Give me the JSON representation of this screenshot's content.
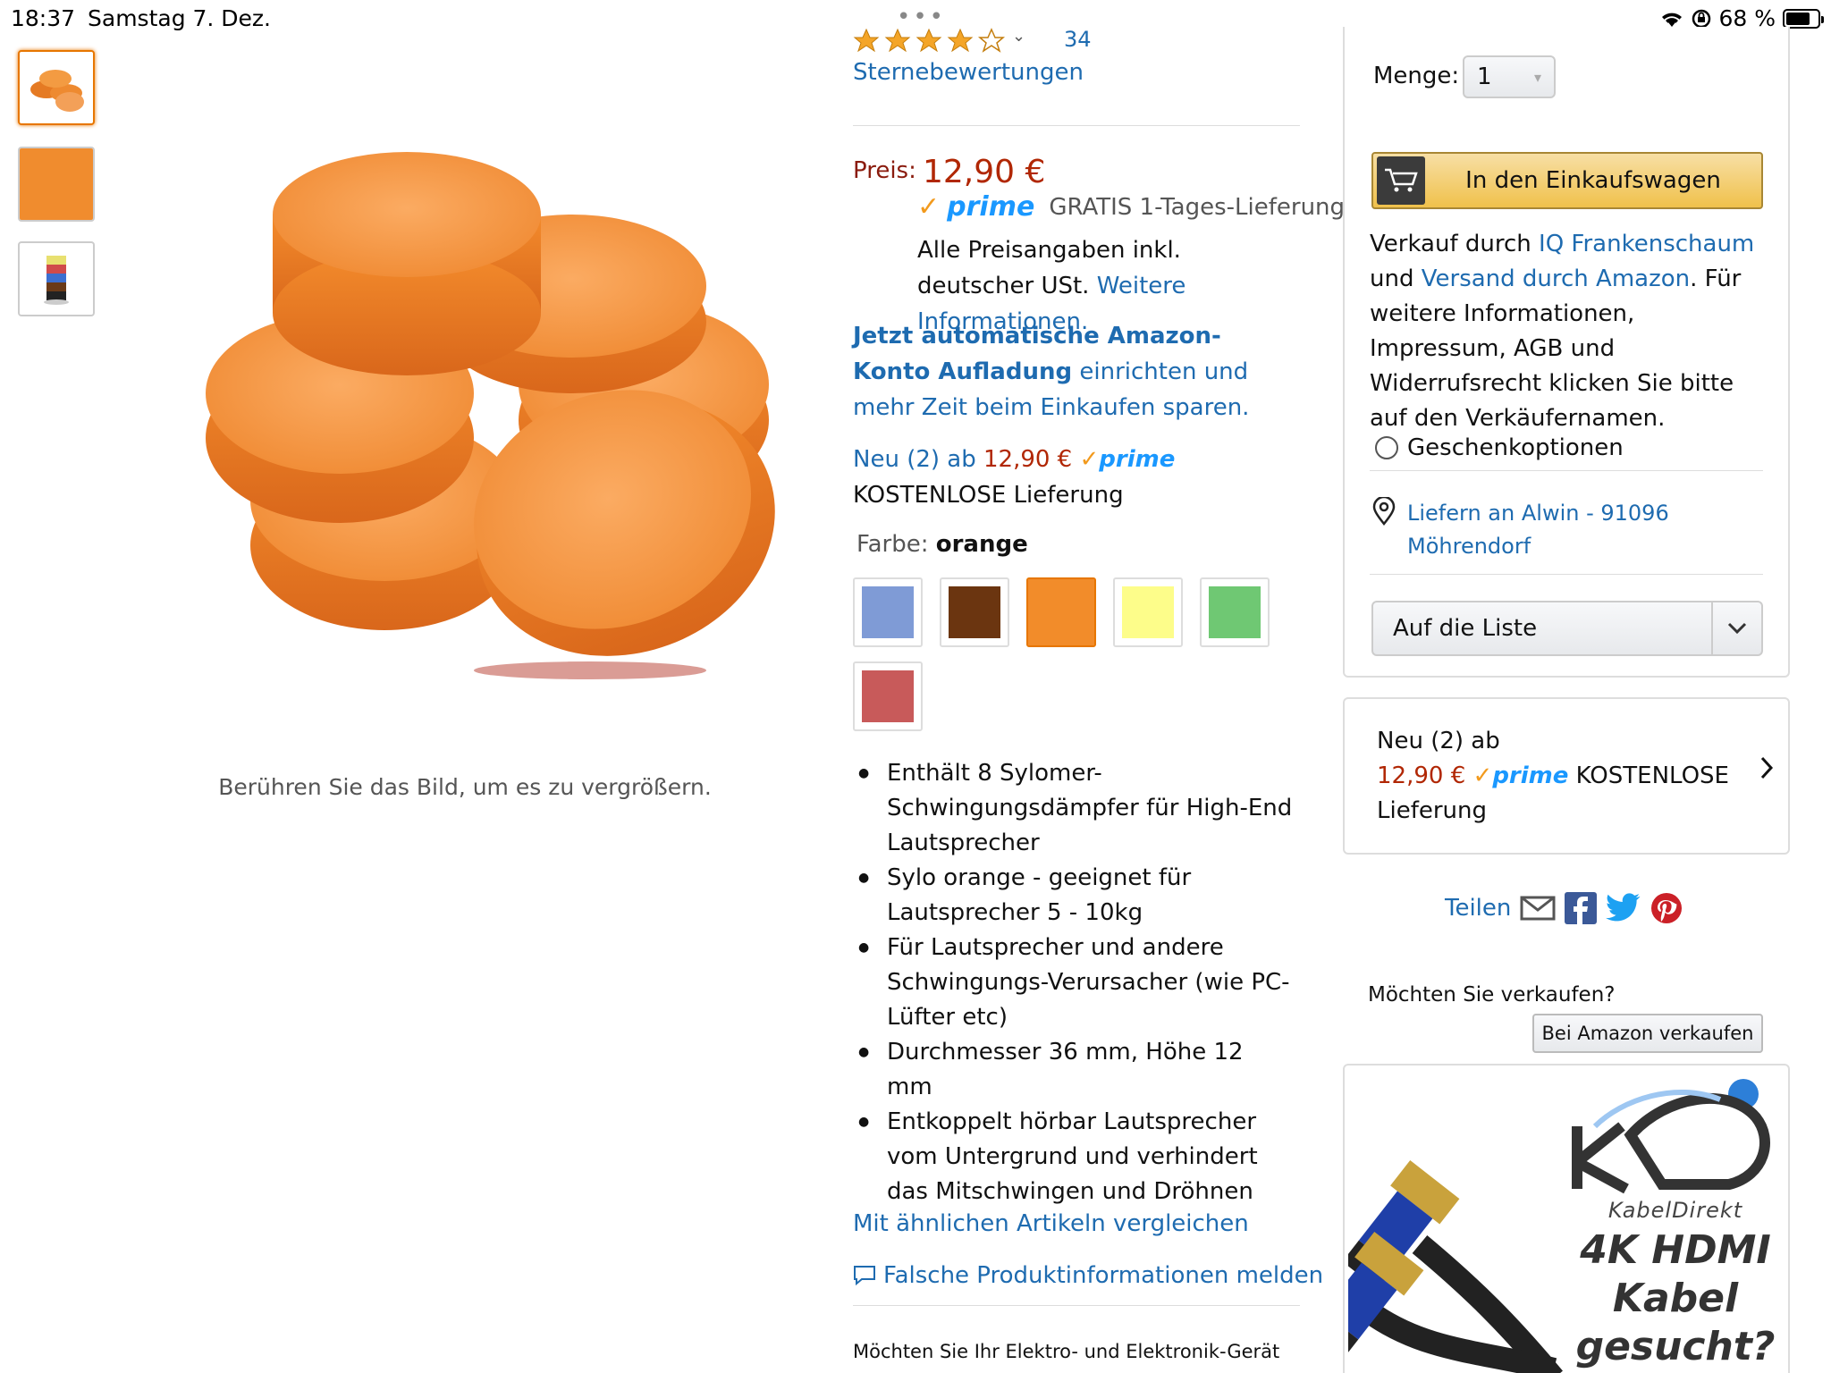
{
  "status_bar": {
    "time": "18:37",
    "date": "Samstag 7. Dez.",
    "battery": "68 %",
    "battery_level": 0.68
  },
  "rating": {
    "count": "34",
    "label": "Sternebewertungen",
    "stars": 4
  },
  "price": {
    "label": "Preis:",
    "value": "12,90 €",
    "prime": "prime",
    "delivery": "GRATIS 1-Tages-Lieferung",
    "tax_note": "Alle Preisangaben inkl. deutscher USt.",
    "tax_link": "Weitere Informationen."
  },
  "promo": {
    "bold": "Jetzt automatische Amazon-Konto Aufladung",
    "rest": " einrichten und mehr Zeit beim Einkaufen sparen."
  },
  "new_offer": {
    "prefix": "Neu (2) ab ",
    "price": "12,90 €",
    "prime": "prime",
    "delivery": "KOSTENLOSE Lieferung"
  },
  "color": {
    "label": "Farbe:",
    "value": "orange",
    "swatches": [
      "#7f9bd6",
      "#6b3510",
      "#f28c2a",
      "#fdfd8a",
      "#6fc873",
      "#c85a5a"
    ]
  },
  "bullets": [
    "Enthält 8 Sylomer-Schwingungsdämpfer für High-End Lautsprecher",
    "Sylo orange - geeignet für Lautsprecher 5 - 10kg",
    "Für Lautsprecher und andere Schwingungs-Verursacher (wie PC-Lüfter etc)",
    "Durchmesser 36 mm, Höhe 12 mm",
    "Entkoppelt hörbar Lautsprecher vom Untergrund und verhindert das Mitschwingen und Dröhnen"
  ],
  "links": {
    "compare": "Mit ähnlichen Artikeln vergleichen",
    "report": "Falsche Produktinformationen melden"
  },
  "bottom_note": "Möchten Sie Ihr Elektro- und Elektronik-Gerät",
  "image_caption": "Berühren Sie das Bild, um es zu vergrößern.",
  "buybox": {
    "qty_label": "Menge:",
    "qty_value": "1",
    "cart_button": "In den Einkaufswagen",
    "seller_pre": "Verkauf durch ",
    "seller": "IQ Frankenschaum",
    "ship_pre": "und ",
    "ship": "Versand durch Amazon",
    "seller_post": ". Für weitere Informationen, Impressum, AGB und Widerrufsrecht klicken Sie bitte auf den Verkäufernamen.",
    "gift": "Geschenkoptionen",
    "deliver_to": "Liefern an Alwin - 91096 Möhrendorf",
    "list_button": "Auf die Liste"
  },
  "offer_box": {
    "line1": "Neu (2) ab",
    "price": "12,90 €",
    "prime": "prime",
    "delivery": "KOSTENLOSE Lieferung"
  },
  "share": {
    "label": "Teilen"
  },
  "sell": {
    "question": "Möchten Sie verkaufen?",
    "button": "Bei Amazon verkaufen"
  },
  "ad": {
    "brand": "KabelDirekt",
    "headline": "4K HDMI Kabel gesucht?"
  }
}
